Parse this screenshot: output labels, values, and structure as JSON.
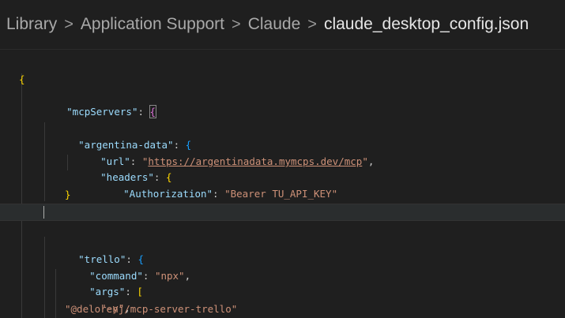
{
  "breadcrumb": {
    "items": [
      "Library",
      "Application Support",
      "Claude",
      "claude_desktop_config.json"
    ],
    "separator": ">"
  },
  "code": {
    "open_brace": "{",
    "mcpServers_key": "\"mcpServers\"",
    "colon": ": ",
    "argentina_key": "\"argentina-data\"",
    "url_key": "\"url\"",
    "url_quote_open": "\"",
    "url_value": "https://argentinadata.mymcps.dev/mcp",
    "url_quote_close": "\"",
    "headers_key": "\"headers\"",
    "authorization_key": "\"Authorization\"",
    "authorization_value": "\"Bearer TU_API_KEY\"",
    "trello_key": "\"trello\"",
    "command_key": "\"command\"",
    "command_value": "\"npx\"",
    "args_key": "\"args\"",
    "arg_1": "\"-y\"",
    "arg_2": "\"@delorenj/mcp-server-trello\""
  }
}
